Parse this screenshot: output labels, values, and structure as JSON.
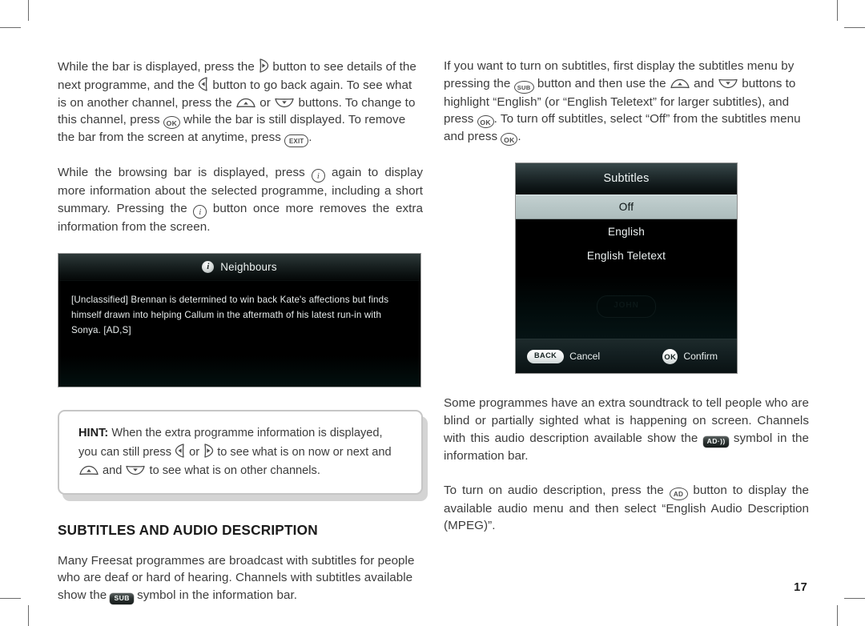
{
  "page": {
    "number": "17"
  },
  "left_column": {
    "para1": {
      "s1": "While the bar is displayed, press the ",
      "s2": " button to see details of the next programme, and the ",
      "s3": " button to go back again. To see what is on another channel, press the ",
      "s4": " or ",
      "s5": " buttons. To change to this channel, press ",
      "s6": " while the bar is still displayed. To remove the bar from the screen at anytime, press ",
      "s7": ".",
      "key_right": "right-arrow-key",
      "key_left": "left-arrow-key",
      "key_up": "up-arrow-key",
      "key_down": "down-arrow-key",
      "key_ok": "OK",
      "key_exit": "EXIT"
    },
    "para2": {
      "s1": "While the browsing bar is displayed, press ",
      "s2": " again to display more information about the selected programme, including a short summary. Pressing the ",
      "s3": " button once more removes the extra information from the screen.",
      "key_info": "i"
    },
    "info_panel": {
      "icon": "info-icon",
      "title": "Neighbours",
      "description": "[Unclassified] Brennan is determined to win back Kate's affections but finds himself drawn into helping Callum in the aftermath of his latest run-in with Sonya. [AD,S]"
    },
    "hint": {
      "label": "HINT:",
      "s1": " When the extra programme information is displayed, you can still press ",
      "s2": " or ",
      "s3": " to see what is on now or next and ",
      "s4": " and ",
      "s5": " to see what is on other channels."
    },
    "section_heading": "Subtitles and audio description",
    "para3": {
      "s1": "Many Freesat programmes are broadcast with subtitles for people who are deaf or hard of hearing. Channels with subtitles available show the ",
      "s2": " symbol in the information bar.",
      "badge_sub": "SUB"
    }
  },
  "right_column": {
    "para1": {
      "s1": "If you want to turn on subtitles, first display the subtitles menu by pressing the ",
      "s2": " button and then use the ",
      "s3": " and ",
      "s4": " buttons to highlight “English” (or “English Teletext” for larger subtitles), and press ",
      "s5": ". To turn off subtitles, select “Off” from the subtitles menu and press ",
      "s6": ".",
      "key_sub": "SUB",
      "key_ok": "OK"
    },
    "subtitles_menu": {
      "title": "Subtitles",
      "items": [
        {
          "label": "Off",
          "selected": true
        },
        {
          "label": "English",
          "selected": false
        },
        {
          "label": "English Teletext",
          "selected": false
        }
      ],
      "watermark": "JOHN",
      "footer": {
        "back_key": "BACK",
        "back_label": "Cancel",
        "ok_key": "OK",
        "ok_label": "Confirm"
      }
    },
    "para2": {
      "s1": "Some programmes have an extra soundtrack to tell people who are blind or partially sighted what is happening on screen. Channels with this audio description available show the ",
      "s2": " symbol in the information bar.",
      "badge_ad": "AD"
    },
    "para3": {
      "s1": "To turn on audio description, press the ",
      "s2": " button to display the available audio menu and then select “English Audio Description (MPEG)”.",
      "key_ad": "AD"
    }
  },
  "colors": {
    "text": "#3c3c3c",
    "heading": "#1b1b1b",
    "panel_bg": "#000000",
    "panel_border": "#9f9f9f",
    "selected_row": "#b7c6c6",
    "hint_border": "#c6c6c6"
  }
}
